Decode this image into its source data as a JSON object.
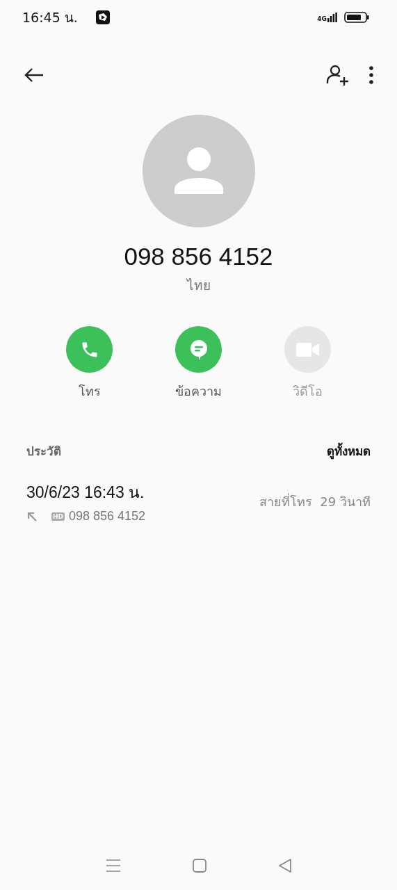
{
  "status_bar": {
    "time": "16:45 น.",
    "network": "4G"
  },
  "contact": {
    "number": "098 856 4152",
    "location": "ไทย"
  },
  "actions": [
    {
      "kind": "call",
      "label": "โทร",
      "disabled": false
    },
    {
      "kind": "message",
      "label": "ข้อความ",
      "disabled": false
    },
    {
      "kind": "video",
      "label": "วิดีโอ",
      "disabled": true
    }
  ],
  "history": {
    "title": "ประวัติ",
    "see_all": "ดูทั้งหมด",
    "entries": [
      {
        "datetime": "30/6/23 16:43 น.",
        "badge": "HD",
        "number": "098 856 4152",
        "type": "สายที่โทร",
        "duration": "29 วินาที"
      }
    ]
  }
}
